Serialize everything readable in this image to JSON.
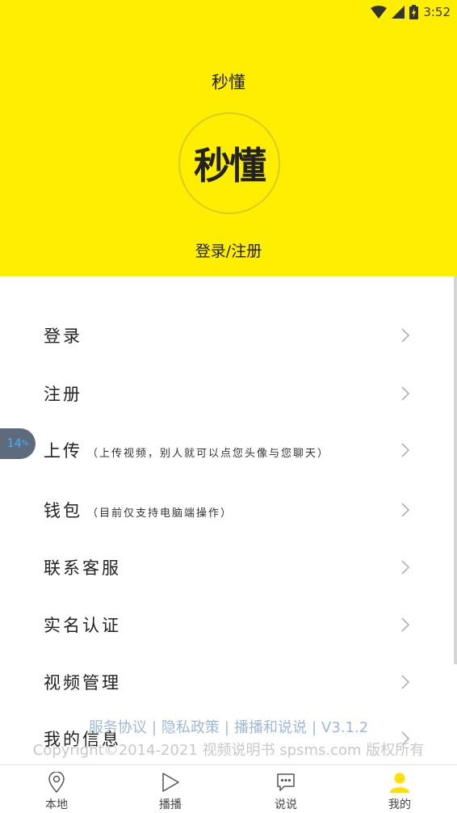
{
  "status_bar": {
    "time": "3:52"
  },
  "header": {
    "app_name": "秒懂",
    "logo_text": "秒懂",
    "login_register": "登录/注册",
    "bg_color": "#ffee00"
  },
  "float_badge": {
    "value": "14",
    "unit": "%"
  },
  "menu": [
    {
      "label": "登录",
      "note": ""
    },
    {
      "label": "注册",
      "note": ""
    },
    {
      "label": "上传",
      "note": "（上传视频，别人就可以点您头像与您聊天）"
    },
    {
      "label": "钱包",
      "note": "（目前仅支持电脑端操作）"
    },
    {
      "label": "联系客服",
      "note": ""
    },
    {
      "label": "实名认证",
      "note": ""
    },
    {
      "label": "视频管理",
      "note": ""
    },
    {
      "label": "我的信息",
      "note": ""
    }
  ],
  "footer": {
    "links": [
      "服务协议",
      "隐私政策",
      "播播和说说",
      "V3.1.2"
    ],
    "separator": "|",
    "copyright": "Copyright©2014-2021 视频说明书 spsms.com 版权所有"
  },
  "tabs": [
    {
      "label": "本地",
      "icon": "location-pin-icon"
    },
    {
      "label": "播播",
      "icon": "play-icon"
    },
    {
      "label": "说说",
      "icon": "chat-bubble-icon"
    },
    {
      "label": "我的",
      "icon": "user-icon",
      "active": true
    }
  ],
  "colors": {
    "accent": "#ffee00",
    "link": "#9fb8d6",
    "active_tab_icon": "#ffe000"
  }
}
